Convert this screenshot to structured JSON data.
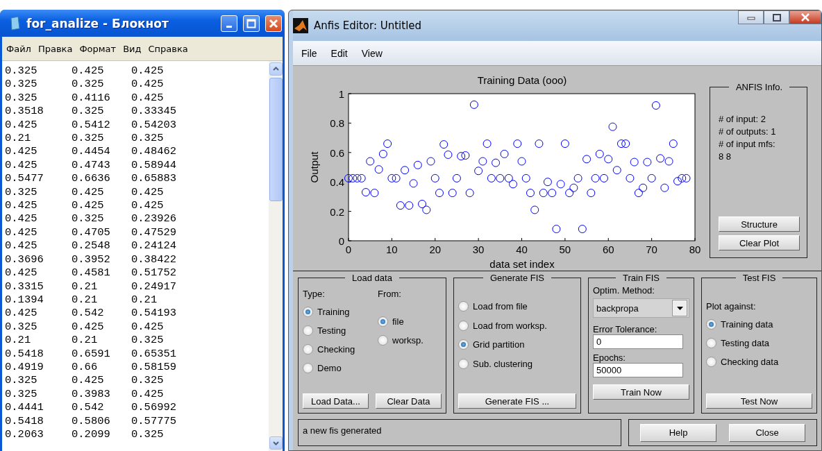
{
  "notepad": {
    "title": "for_analize - Блокнот",
    "menu": [
      "Файл",
      "Правка",
      "Формат",
      "Вид",
      "Справка"
    ],
    "rows": [
      [
        "0.325",
        "0.425",
        "0.425"
      ],
      [
        "0.325",
        "0.325",
        "0.425"
      ],
      [
        "0.325",
        "0.4116",
        "0.425"
      ],
      [
        "0.3518",
        "0.325",
        "0.33345"
      ],
      [
        "0.425",
        "0.5412",
        "0.54203"
      ],
      [
        "0.21",
        "0.325",
        "0.325"
      ],
      [
        "0.425",
        "0.4454",
        "0.48462"
      ],
      [
        "0.425",
        "0.4743",
        "0.58944"
      ],
      [
        "0.5477",
        "0.6636",
        "0.65883"
      ],
      [
        "0.325",
        "0.425",
        "0.425"
      ],
      [
        "0.425",
        "0.425",
        "0.425"
      ],
      [
        "0.425",
        "0.325",
        "0.23926"
      ],
      [
        "0.425",
        "0.4705",
        "0.47529"
      ],
      [
        "0.425",
        "0.2548",
        "0.24124"
      ],
      [
        "0.3696",
        "0.3952",
        "0.38422"
      ],
      [
        "0.425",
        "0.4581",
        "0.51752"
      ],
      [
        "0.3315",
        "0.21",
        "0.24917"
      ],
      [
        "0.1394",
        "0.21",
        "0.21"
      ],
      [
        "0.425",
        "0.542",
        "0.54193"
      ],
      [
        "0.325",
        "0.425",
        "0.425"
      ],
      [
        "0.21",
        "0.21",
        "0.325"
      ],
      [
        "0.5418",
        "0.6591",
        "0.65351"
      ],
      [
        "0.4919",
        "0.66",
        "0.58159"
      ],
      [
        "0.325",
        "0.425",
        "0.325"
      ],
      [
        "0.325",
        "0.3983",
        "0.425"
      ],
      [
        "0.4441",
        "0.542",
        "0.56992"
      ],
      [
        "0.5418",
        "0.5806",
        "0.57775"
      ],
      [
        "0.2063",
        "0.2099",
        "0.325"
      ]
    ]
  },
  "anfis": {
    "title": "Anfis Editor: Untitled",
    "menu": [
      "File",
      "Edit",
      "View"
    ],
    "plot": {
      "chart_data": {
        "type": "scatter",
        "title": "Training Data (ooo)",
        "xlabel": "data set index",
        "ylabel": "Output",
        "xlim": [
          0,
          80
        ],
        "ylim": [
          0,
          1
        ],
        "xticks": [
          0,
          10,
          20,
          30,
          40,
          50,
          60,
          70,
          80
        ],
        "yticks": [
          0,
          0.2,
          0.4,
          0.6,
          0.8,
          1
        ],
        "x": [
          0,
          1,
          2,
          3,
          4,
          5,
          6,
          7,
          8,
          9,
          10,
          11,
          12,
          13,
          14,
          15,
          16,
          17,
          18,
          19,
          20,
          21,
          22,
          23,
          24,
          25,
          26,
          27,
          28,
          29,
          30,
          31,
          32,
          33,
          34,
          35,
          36,
          37,
          38,
          39,
          40,
          41,
          42,
          43,
          44,
          45,
          46,
          47,
          48,
          49,
          50,
          51,
          52,
          53,
          54,
          55,
          56,
          57,
          58,
          59,
          60,
          61,
          62,
          63,
          64,
          65,
          66,
          67,
          68,
          69,
          70,
          71,
          72,
          73,
          74,
          75,
          76,
          77,
          78
        ],
        "series": [
          {
            "color": "#0000ff",
            "values": [
              0.425,
              0.425,
              0.425,
              0.425,
              0.33,
              0.54,
              0.325,
              0.485,
              0.59,
              0.66,
              0.425,
              0.425,
              0.24,
              0.48,
              0.24,
              0.39,
              0.515,
              0.25,
              0.21,
              0.54,
              0.425,
              0.325,
              0.655,
              0.585,
              0.325,
              0.425,
              0.575,
              0.58,
              0.325,
              0.925,
              0.475,
              0.54,
              0.66,
              0.425,
              0.53,
              0.425,
              0.59,
              0.425,
              0.385,
              0.66,
              0.54,
              0.425,
              0.325,
              0.21,
              0.66,
              0.325,
              0.4,
              0.325,
              0.08,
              0.385,
              0.66,
              0.325,
              0.36,
              0.425,
              0.08,
              0.555,
              0.325,
              0.425,
              0.59,
              0.425,
              0.555,
              0.775,
              0.48,
              0.66,
              0.66,
              0.425,
              0.535,
              0.325,
              0.36,
              0.535,
              0.425,
              0.92,
              0.56,
              0.36,
              0.54,
              0.66,
              0.405,
              0.425,
              0.425
            ]
          }
        ]
      }
    },
    "info": {
      "title": "ANFIS Info.",
      "lines": [
        "# of input: 2",
        "# of outputs: 1",
        "# of input mfs:",
        "8  8"
      ],
      "buttons": [
        "Structure",
        "Clear Plot"
      ]
    },
    "load_data": {
      "title": "Load data",
      "type_label": "Type:",
      "from_label": "From:",
      "type_options": [
        {
          "label": "Training",
          "selected": true
        },
        {
          "label": "Testing",
          "selected": false
        },
        {
          "label": "Checking",
          "selected": false
        },
        {
          "label": "Demo",
          "selected": false
        }
      ],
      "from_options": [
        {
          "label": "file",
          "selected": true
        },
        {
          "label": "worksp.",
          "selected": false
        }
      ],
      "buttons": [
        "Load Data...",
        "Clear Data"
      ]
    },
    "generate_fis": {
      "title": "Generate FIS",
      "options": [
        {
          "label": "Load from file",
          "selected": false
        },
        {
          "label": "Load from worksp.",
          "selected": false
        },
        {
          "label": "Grid partition",
          "selected": true
        },
        {
          "label": "Sub. clustering",
          "selected": false
        }
      ],
      "button": "Generate FIS ..."
    },
    "train_fis": {
      "title": "Train FIS",
      "method_label": "Optim. Method:",
      "method": "backpropa",
      "tolerance_label": "Error Tolerance:",
      "tolerance": "0",
      "epochs_label": "Epochs:",
      "epochs": "50000",
      "button": "Train Now"
    },
    "test_fis": {
      "title": "Test FIS",
      "plot_label": "Plot against:",
      "options": [
        {
          "label": "Training data",
          "selected": true
        },
        {
          "label": "Testing data",
          "selected": false
        },
        {
          "label": "Checking data",
          "selected": false
        }
      ],
      "button": "Test Now"
    },
    "status": "a new fis generated",
    "buttons": [
      "Help",
      "Close"
    ]
  }
}
